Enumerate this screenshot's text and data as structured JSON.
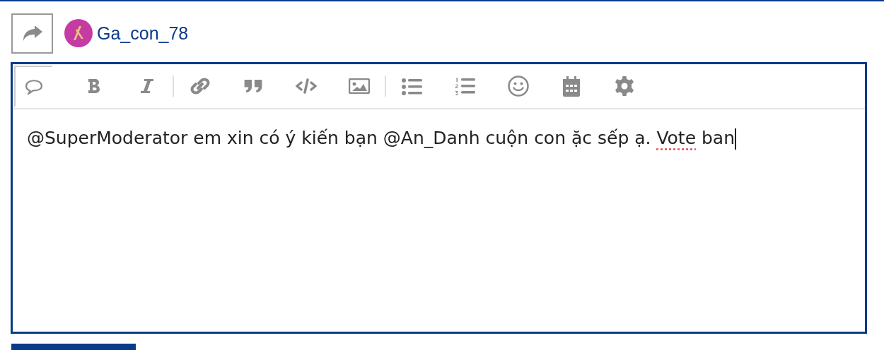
{
  "post_header": {
    "username": "Ga_con_78"
  },
  "toolbar": [
    {
      "kind": "comment",
      "selected": true
    },
    {
      "kind": "bold",
      "selected": false
    },
    {
      "kind": "italic",
      "selected": false
    },
    {
      "kind": "divider"
    },
    {
      "kind": "link",
      "selected": false
    },
    {
      "kind": "quote",
      "selected": false
    },
    {
      "kind": "code",
      "selected": false
    },
    {
      "kind": "image",
      "selected": false
    },
    {
      "kind": "divider"
    },
    {
      "kind": "bullets",
      "selected": false
    },
    {
      "kind": "numbers",
      "selected": false
    },
    {
      "kind": "emoji",
      "selected": false
    },
    {
      "kind": "calendar",
      "selected": false
    },
    {
      "kind": "settings",
      "selected": false
    }
  ],
  "editor": {
    "segments": [
      {
        "text": "@SuperModerator em xin có ý kiến bạn @An_Danh cuộn con ặc sếp ạ. ",
        "misspelled": false
      },
      {
        "text": "Vote",
        "misspelled": true
      },
      {
        "text": " ban",
        "misspelled": false
      }
    ]
  }
}
